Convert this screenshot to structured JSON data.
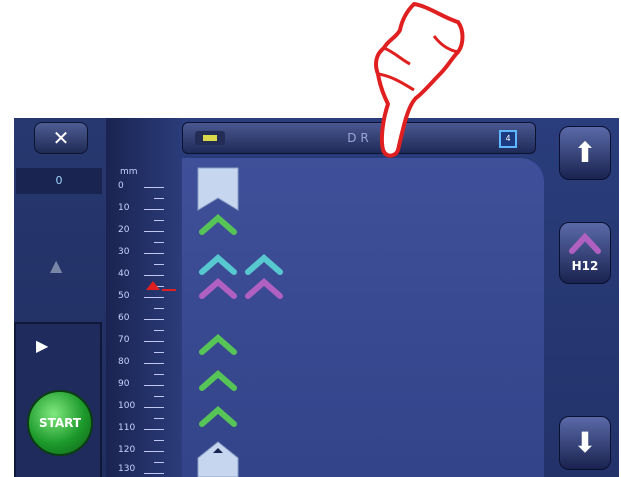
{
  "toolbar": {
    "title": "D  R",
    "badge": "4",
    "counter": "0"
  },
  "ruler": {
    "unit": "mm",
    "labels": [
      "0",
      "10",
      "20",
      "30",
      "40",
      "50",
      "60",
      "70",
      "80",
      "90",
      "100",
      "110",
      "120",
      "130"
    ],
    "marker_value_mm": 48
  },
  "buttons": {
    "start_label": "START",
    "h12_label": "H12"
  },
  "icons": {
    "tools": "tools-icon",
    "warning": "warning-icon",
    "play": "play-icon",
    "up": "arrow-up-icon",
    "down": "arrow-down-icon",
    "folder": "folder-icon",
    "hand": "pointing-hand-icon"
  },
  "colors": {
    "green": "#56c456",
    "cyan": "#58c8d0",
    "purple": "#b060c0",
    "marker": "#e02020",
    "start": "#1d9a2b"
  }
}
